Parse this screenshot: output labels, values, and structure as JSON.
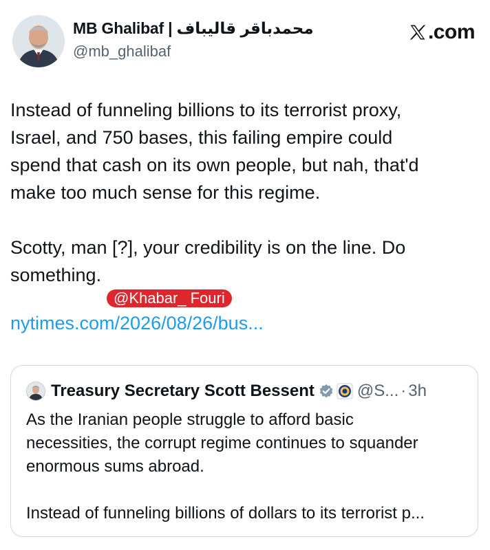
{
  "post": {
    "display_name": "MB Ghalibaf | محمدباقر قالیباف",
    "handle": "@mb_ghalibaf",
    "source": ".com",
    "body": "Instead of funneling billions to its terrorist proxy,\nIsrael, and 750 bases, this failing empire could\nspend that cash on its own people, but nah, that'd\nmake too much sense for this regime.\n\nScotty, man [?], your credibility is on the line. Do\nsomething.",
    "watermark": "@Khabar_ Fouri",
    "link": "nytimes.com/2026/08/26/bus..."
  },
  "quote": {
    "name": "Treasury Secretary Scott Bessent",
    "handle": "@S...",
    "dot": "·",
    "time": "3h",
    "text": "As the Iranian people struggle to afford basic\nnecessities, the corrupt regime continues to squander\nenormous sums abroad.\n\nInstead of funneling billions of dollars to its terrorist p..."
  },
  "icons": {
    "avatar": "profile-photo",
    "x_logo": "x-logo-icon",
    "verified": "gray-verified-badge-icon",
    "seal": "treasury-seal-icon"
  },
  "colors": {
    "link": "#1d9bf0",
    "secondary_text": "#536471",
    "watermark_bg": "#e0262d",
    "border": "#cfd9de"
  }
}
